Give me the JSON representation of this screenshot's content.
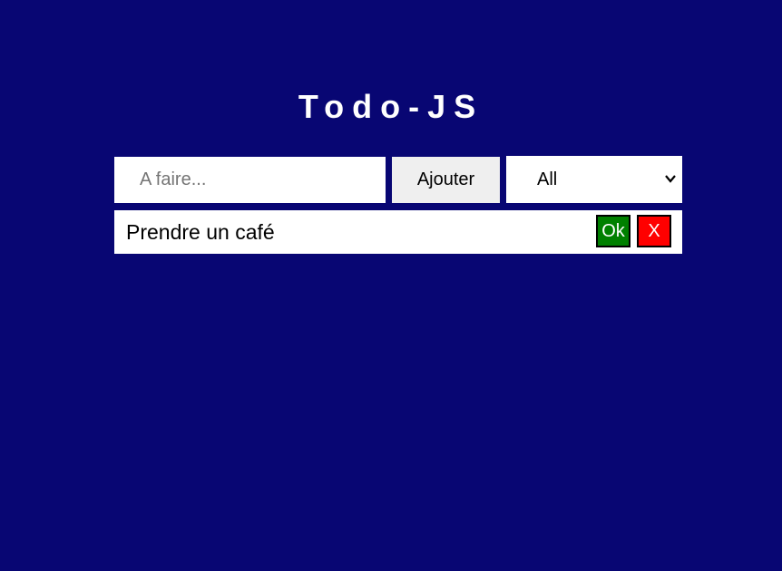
{
  "app": {
    "title": "Todo-JS"
  },
  "form": {
    "input_placeholder": "A faire...",
    "input_value": "",
    "add_button_label": "Ajouter",
    "filter": {
      "selected": "All",
      "icon": "chevron-down-icon"
    }
  },
  "todos": [
    {
      "text": "Prendre un café",
      "ok_label": "Ok",
      "delete_label": "X"
    }
  ],
  "colors": {
    "background": "#080673",
    "ok_button": "#008000",
    "delete_button": "#ff0000",
    "add_button": "#efefef"
  }
}
